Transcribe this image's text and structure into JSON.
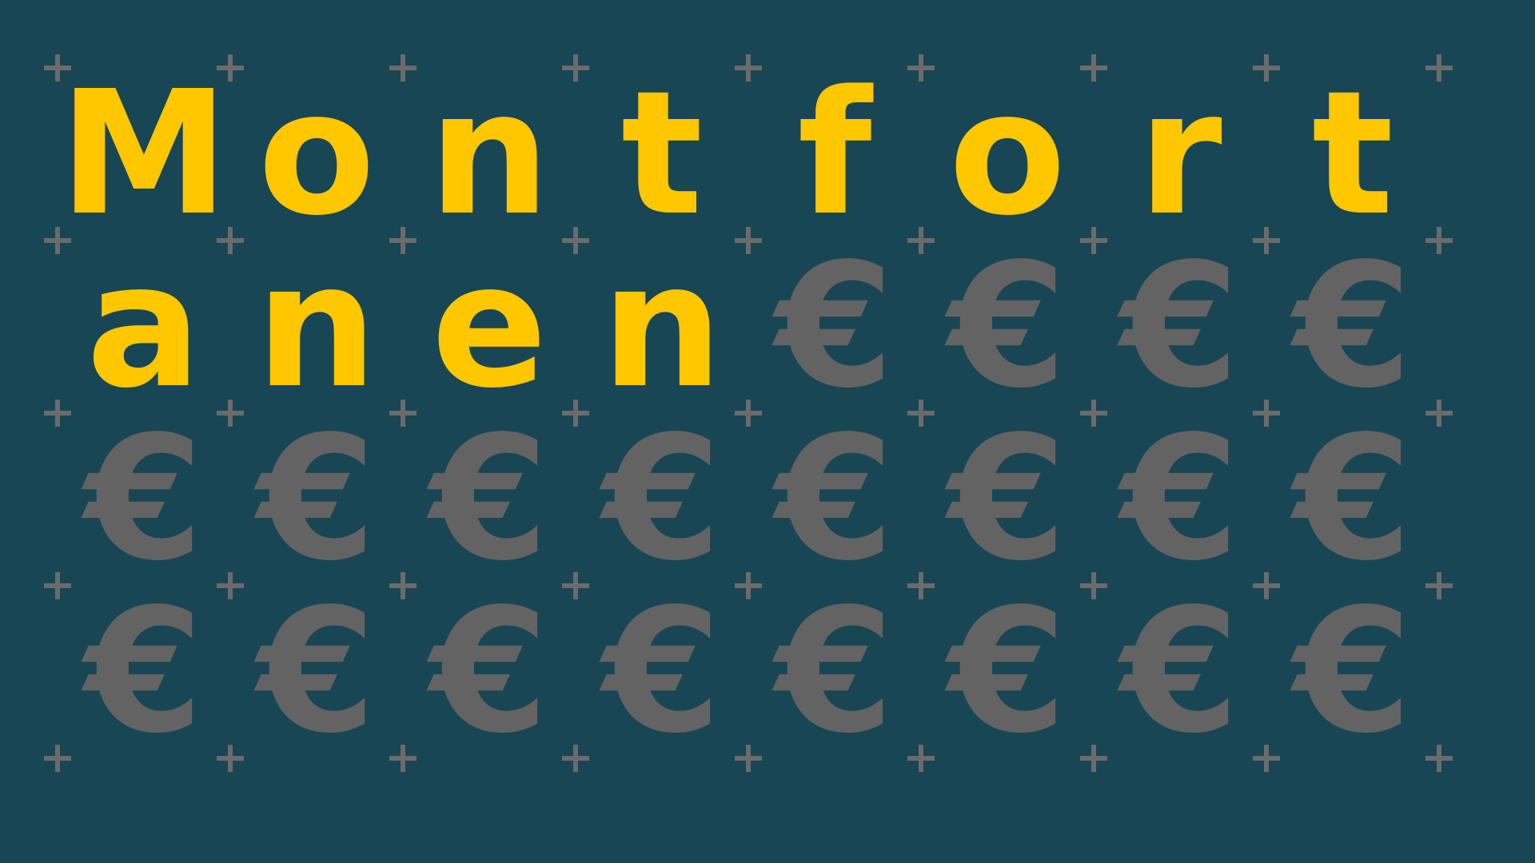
{
  "background_color": "#184655",
  "letter_color": "#ffc700",
  "euro_color": "#636363",
  "marker_color": "#6b6b6b",
  "marker_icon": "plus-icon",
  "rows": [
    [
      "M",
      "o",
      "n",
      "t",
      "f",
      "o",
      "r",
      "t"
    ],
    [
      "a",
      "n",
      "e",
      "n",
      "€",
      "€",
      "€",
      "€"
    ],
    [
      "€",
      "€",
      "€",
      "€",
      "€",
      "€",
      "€",
      "€"
    ],
    [
      "€",
      "€",
      "€",
      "€",
      "€",
      "€",
      "€",
      "€"
    ]
  ]
}
